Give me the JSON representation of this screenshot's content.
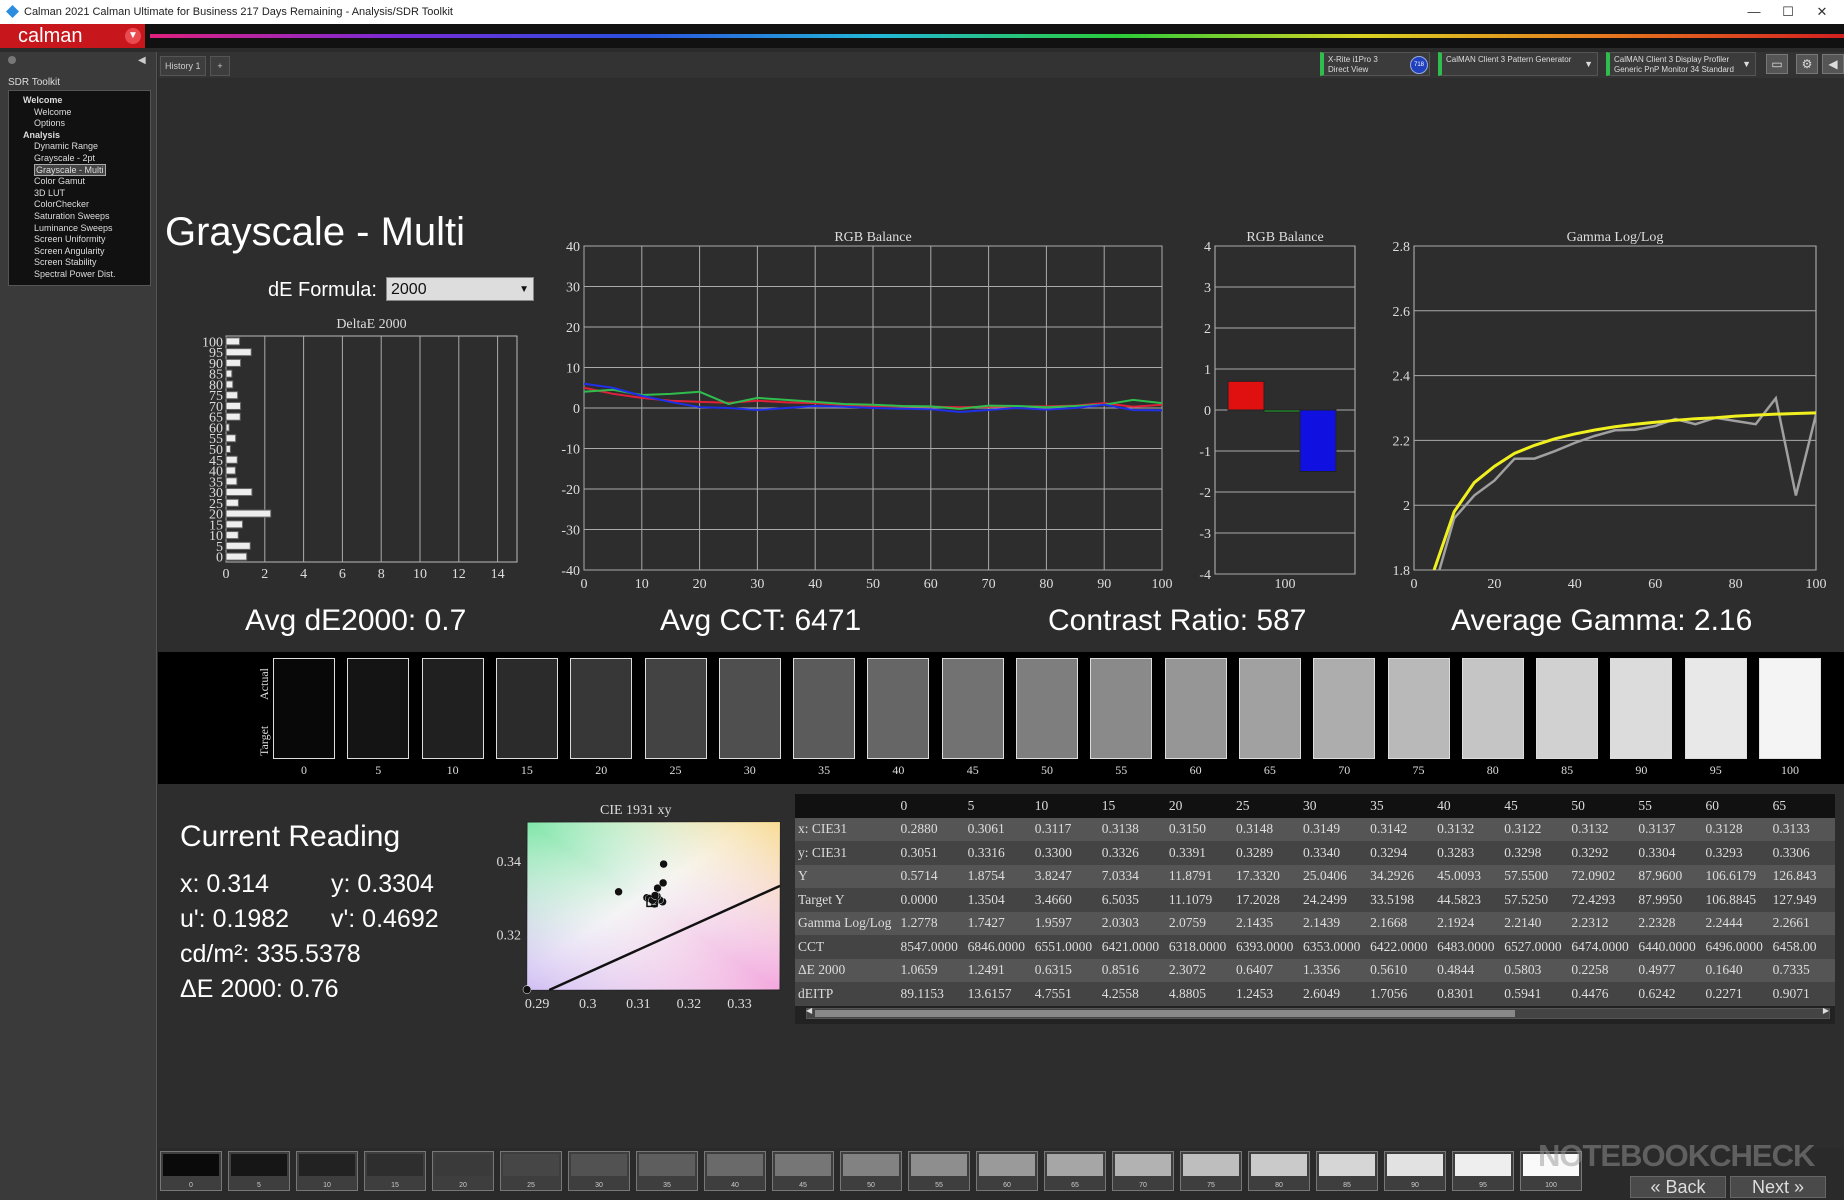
{
  "window": {
    "title": "Calman 2021 Calman Ultimate for Business 217 Days Remaining - Analysis/SDR Toolkit",
    "minimize": "—",
    "maximize": "☐",
    "close": "✕"
  },
  "brand": {
    "logo": "calman"
  },
  "sidebar": {
    "title": "SDR Toolkit",
    "tree": [
      {
        "label": "Welcome",
        "kind": "cat"
      },
      {
        "label": "Welcome",
        "kind": "it"
      },
      {
        "label": "Options",
        "kind": "it"
      },
      {
        "label": "Analysis",
        "kind": "cat"
      },
      {
        "label": "Dynamic Range",
        "kind": "it"
      },
      {
        "label": "Grayscale - 2pt",
        "kind": "it"
      },
      {
        "label": "Grayscale - Multi",
        "kind": "sel"
      },
      {
        "label": "Color Gamut",
        "kind": "it"
      },
      {
        "label": "3D LUT",
        "kind": "it"
      },
      {
        "label": "ColorChecker",
        "kind": "it"
      },
      {
        "label": "Saturation Sweeps",
        "kind": "it"
      },
      {
        "label": "Luminance Sweeps",
        "kind": "it"
      },
      {
        "label": "Screen Uniformity",
        "kind": "it"
      },
      {
        "label": "Screen Angularity",
        "kind": "it"
      },
      {
        "label": "Screen Stability",
        "kind": "it"
      },
      {
        "label": "Spectral Power Dist.",
        "kind": "it"
      }
    ]
  },
  "tabs": {
    "history": "History 1",
    "add": "+"
  },
  "devices": {
    "meter_line1": "X-Rite i1Pro 3",
    "meter_line2": "Direct View",
    "meter_badge": "718",
    "pattern_gen": "CalMAN Client 3 Pattern Generator",
    "profiler_line1": "CalMAN Client 3 Display Profiler",
    "profiler_line2": "Generic PnP Monitor 34 Standard"
  },
  "page": {
    "title": "Grayscale - Multi",
    "de_formula_label": "dE Formula:",
    "de_formula_value": "2000"
  },
  "stats": {
    "avg_de": "Avg dE2000: 0.7",
    "avg_cct": "Avg CCT: 6471",
    "contrast": "Contrast Ratio: 587",
    "avg_gamma": "Average Gamma: 2.16"
  },
  "chart_data": [
    {
      "type": "bar",
      "orientation": "horizontal",
      "title": "DeltaE 2000",
      "categories": [
        0,
        5,
        10,
        15,
        20,
        25,
        30,
        35,
        40,
        45,
        50,
        55,
        60,
        65,
        70,
        75,
        80,
        85,
        90,
        95,
        100
      ],
      "values": [
        1.0659,
        1.2491,
        0.6315,
        0.8516,
        2.3072,
        0.6407,
        1.3356,
        0.561,
        0.4844,
        0.5803,
        0.2258,
        0.4977,
        0.164,
        0.7335,
        0.75,
        0.6,
        0.35,
        0.3,
        0.75,
        1.3,
        0.7
      ],
      "xlim": [
        0,
        15
      ],
      "xticks": [
        0,
        2,
        4,
        6,
        8,
        10,
        12,
        14
      ]
    },
    {
      "type": "line",
      "title": "RGB Balance",
      "x": [
        0,
        5,
        10,
        15,
        20,
        25,
        30,
        35,
        40,
        45,
        50,
        55,
        60,
        65,
        70,
        75,
        80,
        85,
        90,
        95,
        100
      ],
      "series": [
        {
          "color": "#e0203a",
          "values": [
            5,
            3.5,
            2.5,
            1.8,
            1.5,
            1.3,
            1.8,
            1.4,
            1.2,
            0.8,
            0.5,
            0.4,
            0.3,
            0.2,
            0.3,
            0.4,
            0.4,
            0.6,
            1.2,
            0.3,
            0.8
          ]
        },
        {
          "color": "#2fbe4d",
          "values": [
            4,
            4.5,
            3.2,
            3.5,
            4,
            1,
            2.5,
            2,
            1.5,
            1,
            0.8,
            0.5,
            0.4,
            -0.2,
            0.6,
            0.5,
            0.2,
            0.5,
            0.8,
            2.0,
            1.2
          ]
        },
        {
          "color": "#2030e8",
          "values": [
            6,
            5,
            3,
            1.5,
            0.2,
            0,
            -0.5,
            0,
            0.5,
            0.3,
            0,
            -0.2,
            -0.3,
            -1,
            -0.5,
            0,
            -0.4,
            0,
            0.8,
            -0.5,
            -0.6
          ]
        }
      ],
      "ylim": [
        -40,
        40
      ],
      "yticks": [
        -40,
        -30,
        -20,
        -10,
        0,
        10,
        20,
        30,
        40
      ],
      "xticks": [
        0,
        10,
        20,
        30,
        40,
        50,
        60,
        70,
        80,
        90,
        100
      ]
    },
    {
      "type": "bar",
      "title": "RGB Balance",
      "categories": [
        "100"
      ],
      "series": [
        {
          "color": "#e01010",
          "values": [
            0.7
          ]
        },
        {
          "color": "#1faa2a",
          "values": [
            -0.05
          ]
        },
        {
          "color": "#1010e0",
          "values": [
            -1.5
          ]
        }
      ],
      "ylim": [
        -4,
        4
      ],
      "yticks": [
        -4,
        -3,
        -2,
        -1,
        0,
        1,
        2,
        3,
        4
      ]
    },
    {
      "type": "line",
      "title": "Gamma Log/Log",
      "x": [
        5,
        10,
        15,
        20,
        25,
        30,
        35,
        40,
        45,
        50,
        55,
        60,
        65,
        70,
        75,
        80,
        85,
        90,
        95,
        100
      ],
      "series": [
        {
          "color": "#a0a0a0",
          "values": [
            1.7427,
            1.9597,
            2.0303,
            2.0759,
            2.1435,
            2.1439,
            2.1668,
            2.1924,
            2.214,
            2.2312,
            2.2328,
            2.2444,
            2.2661,
            2.25,
            2.27,
            2.26,
            2.25,
            2.33,
            2.03,
            2.28
          ]
        },
        {
          "color": "#f0f020",
          "values": [
            1.8,
            1.98,
            2.07,
            2.12,
            2.16,
            2.185,
            2.205,
            2.22,
            2.232,
            2.242,
            2.25,
            2.256,
            2.262,
            2.267,
            2.27,
            2.275,
            2.278,
            2.281,
            2.283,
            2.285
          ]
        }
      ],
      "ylim": [
        1.8,
        2.8
      ],
      "yticks": [
        1.8,
        2,
        2.2,
        2.4,
        2.6,
        2.8
      ],
      "xticks": [
        0,
        20,
        40,
        60,
        80,
        100
      ]
    },
    {
      "type": "scatter",
      "title": "CIE 1931 xy",
      "xticks": [
        0.29,
        0.3,
        0.31,
        0.32,
        0.33
      ],
      "yticks": [
        0.32,
        0.34
      ],
      "xlim": [
        0.288,
        0.338
      ],
      "ylim": [
        0.305,
        0.3505
      ],
      "points": [
        [
          0.3061,
          0.3316
        ],
        [
          0.3117,
          0.33
        ],
        [
          0.3138,
          0.3326
        ],
        [
          0.315,
          0.3391
        ],
        [
          0.3148,
          0.3289
        ],
        [
          0.3149,
          0.334
        ],
        [
          0.3142,
          0.3294
        ],
        [
          0.3132,
          0.3283
        ],
        [
          0.3122,
          0.3298
        ],
        [
          0.3132,
          0.3292
        ],
        [
          0.3137,
          0.3304
        ],
        [
          0.3128,
          0.3293
        ],
        [
          0.3133,
          0.3306
        ],
        [
          0.288,
          0.3051
        ]
      ],
      "target": [
        0.3127,
        0.329
      ]
    }
  ],
  "swatches": {
    "actual_label": "Actual",
    "target_label": "Target",
    "levels": [
      "0",
      "5",
      "10",
      "15",
      "20",
      "25",
      "30",
      "35",
      "40",
      "45",
      "50",
      "55",
      "60",
      "65",
      "70",
      "75",
      "80",
      "85",
      "90",
      "95",
      "100"
    ]
  },
  "reading": {
    "title": "Current Reading",
    "x": "x: 0.314",
    "y": "y: 0.3304",
    "u": "u': 0.1982",
    "v": "v': 0.4692",
    "cd": "cd/m²: 335.5378",
    "de": "ΔE 2000: 0.76"
  },
  "table": {
    "columns": [
      "0",
      "5",
      "10",
      "15",
      "20",
      "25",
      "30",
      "35",
      "40",
      "45",
      "50",
      "55",
      "60",
      "65"
    ],
    "rows": [
      {
        "label": "x: CIE31",
        "values": [
          "0.2880",
          "0.3061",
          "0.3117",
          "0.3138",
          "0.3150",
          "0.3148",
          "0.3149",
          "0.3142",
          "0.3132",
          "0.3122",
          "0.3132",
          "0.3137",
          "0.3128",
          "0.3133"
        ]
      },
      {
        "label": "y: CIE31",
        "values": [
          "0.3051",
          "0.3316",
          "0.3300",
          "0.3326",
          "0.3391",
          "0.3289",
          "0.3340",
          "0.3294",
          "0.3283",
          "0.3298",
          "0.3292",
          "0.3304",
          "0.3293",
          "0.3306"
        ]
      },
      {
        "label": "Y",
        "values": [
          "0.5714",
          "1.8754",
          "3.8247",
          "7.0334",
          "11.8791",
          "17.3320",
          "25.0406",
          "34.2926",
          "45.0093",
          "57.5500",
          "72.0902",
          "87.9600",
          "106.6179",
          "126.843"
        ]
      },
      {
        "label": "Target Y",
        "values": [
          "0.0000",
          "1.3504",
          "3.4660",
          "6.5035",
          "11.1079",
          "17.2028",
          "24.2499",
          "33.5198",
          "44.5823",
          "57.5250",
          "72.4293",
          "87.9950",
          "106.8845",
          "127.949"
        ]
      },
      {
        "label": "Gamma Log/Log",
        "values": [
          "1.2778",
          "1.7427",
          "1.9597",
          "2.0303",
          "2.0759",
          "2.1435",
          "2.1439",
          "2.1668",
          "2.1924",
          "2.2140",
          "2.2312",
          "2.2328",
          "2.2444",
          "2.2661"
        ]
      },
      {
        "label": "CCT",
        "values": [
          "8547.0000",
          "6846.0000",
          "6551.0000",
          "6421.0000",
          "6318.0000",
          "6393.0000",
          "6353.0000",
          "6422.0000",
          "6483.0000",
          "6527.0000",
          "6474.0000",
          "6440.0000",
          "6496.0000",
          "6458.00"
        ]
      },
      {
        "label": "ΔE 2000",
        "values": [
          "1.0659",
          "1.2491",
          "0.6315",
          "0.8516",
          "2.3072",
          "0.6407",
          "1.3356",
          "0.5610",
          "0.4844",
          "0.5803",
          "0.2258",
          "0.4977",
          "0.1640",
          "0.7335"
        ]
      },
      {
        "label": "dEITP",
        "values": [
          "89.1153",
          "13.6157",
          "4.7551",
          "4.2558",
          "4.8805",
          "1.2453",
          "2.6049",
          "1.7056",
          "0.8301",
          "0.5941",
          "0.4476",
          "0.6242",
          "0.2271",
          "0.9071"
        ]
      }
    ]
  },
  "bottom": {
    "levels": [
      "0",
      "5",
      "10",
      "15",
      "20",
      "25",
      "30",
      "35",
      "40",
      "45",
      "50",
      "55",
      "60",
      "65",
      "70",
      "75",
      "80",
      "85",
      "90",
      "95",
      "100"
    ],
    "back": "Back",
    "next": "Next"
  },
  "watermark": "NOTEBOOKCHECK"
}
